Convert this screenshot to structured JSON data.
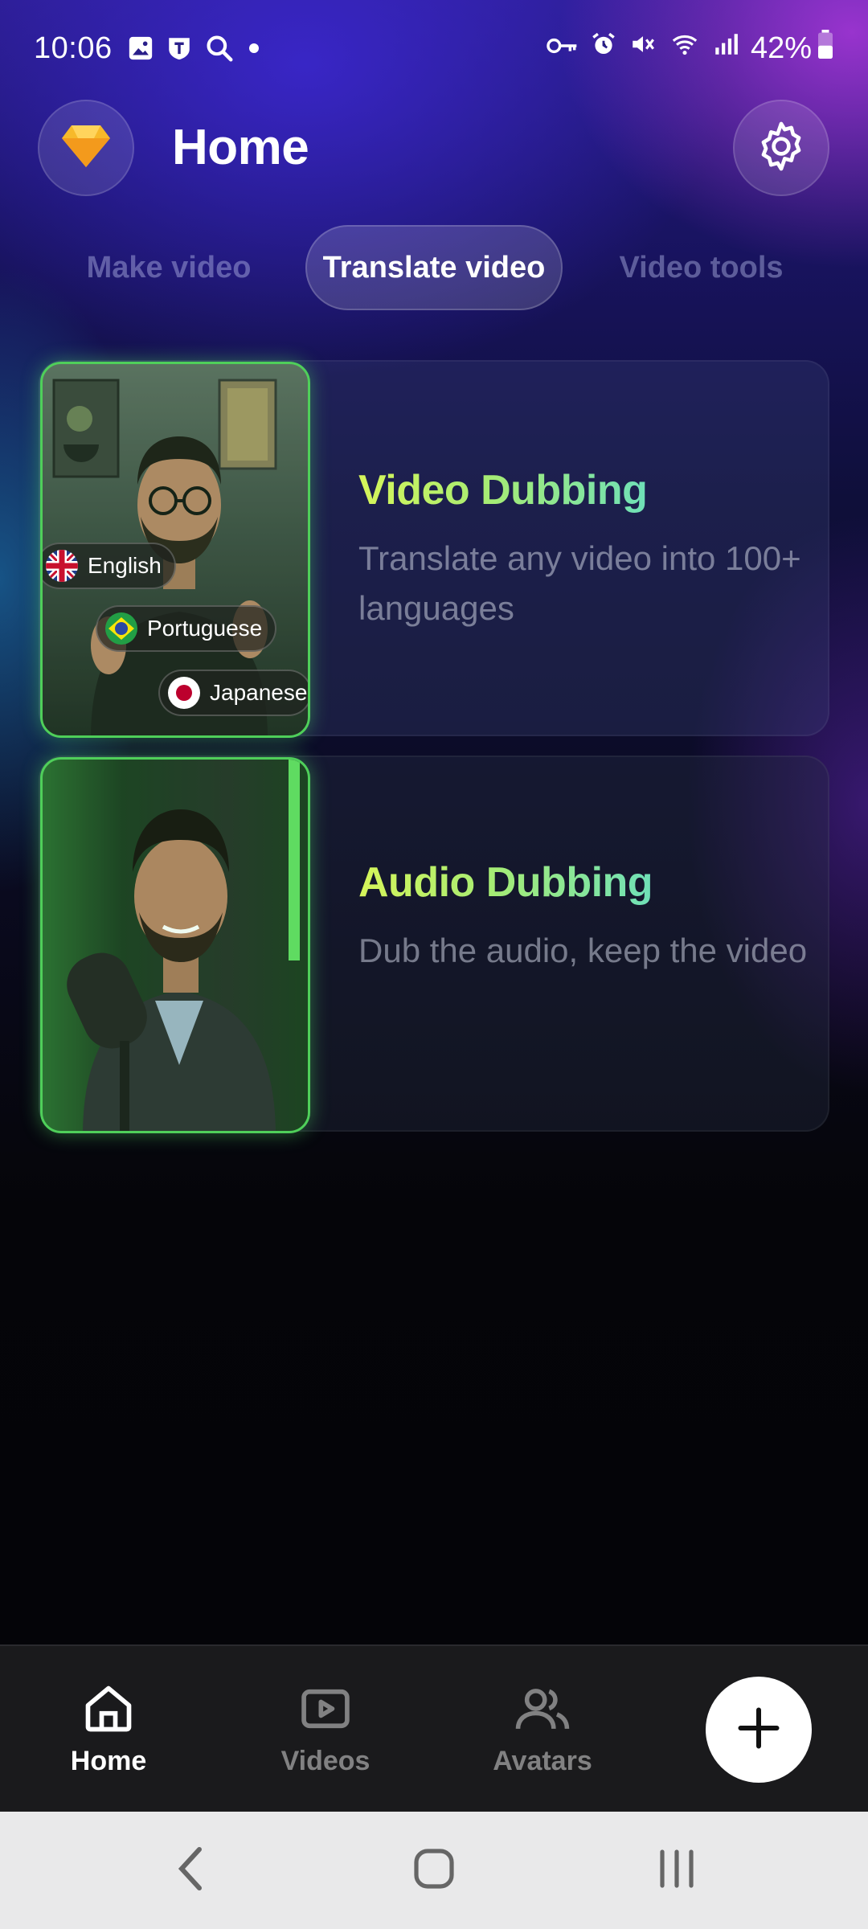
{
  "status_bar": {
    "time": "10:06",
    "battery": "42%",
    "icons_left": [
      "gallery-icon",
      "shield-notification-icon",
      "search-icon",
      "dot-icon"
    ],
    "icons_right": [
      "key-icon",
      "alarm-icon",
      "mute-icon",
      "wifi-icon",
      "signal-icon",
      "battery-icon"
    ]
  },
  "header": {
    "title": "Home",
    "left_button_icon": "diamond-gem-icon",
    "right_button_icon": "gear-icon"
  },
  "tabs": [
    {
      "label": "Make video",
      "active": false
    },
    {
      "label": "Translate video",
      "active": true
    },
    {
      "label": "Video tools",
      "active": false
    }
  ],
  "cards": [
    {
      "title": "Video Dubbing",
      "description": "Translate any video into 100+ languages",
      "languages": [
        "English",
        "Portuguese",
        "Japanese"
      ]
    },
    {
      "title": "Audio Dubbing",
      "description": "Dub the audio, keep the video"
    }
  ],
  "bottom_nav": {
    "items": [
      {
        "label": "Home",
        "icon": "home-icon",
        "active": true
      },
      {
        "label": "Videos",
        "icon": "play-icon",
        "active": false
      },
      {
        "label": "Avatars",
        "icon": "users-icon",
        "active": false
      }
    ],
    "fab_icon": "plus-icon"
  },
  "system_nav": [
    "back-icon",
    "home-circle-icon",
    "recents-icon"
  ],
  "colors": {
    "accent_green": "#4fcf5a",
    "title_gradient_start": "#d6f55a",
    "title_gradient_end": "#6fe0b8",
    "active_tab_text": "#ffffff",
    "inactive_tab_text": "#8d90c0"
  }
}
